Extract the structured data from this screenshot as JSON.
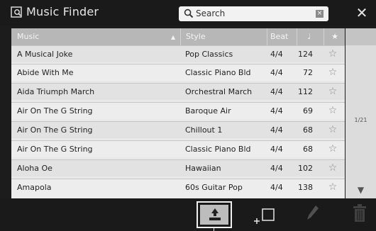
{
  "app": {
    "title": "Music Finder",
    "icon": "music-finder-icon"
  },
  "search": {
    "placeholder": "Search",
    "icon": "search-icon",
    "clear_icon": "clear-icon"
  },
  "close_icon": "close-icon",
  "columns": {
    "music": "Music",
    "style": "Style",
    "beat": "Beat",
    "tempo_icon": "quarter-note-icon",
    "favorite_icon": "star-icon"
  },
  "rows": [
    {
      "music": "A Musical Joke",
      "style": "Pop Classics",
      "beat": "4/4",
      "tempo": "124"
    },
    {
      "music": "Abide With Me",
      "style": "Classic Piano Bld",
      "beat": "4/4",
      "tempo": "72"
    },
    {
      "music": "Aida Triumph March",
      "style": "Orchestral March",
      "beat": "4/4",
      "tempo": "112"
    },
    {
      "music": "Air On The G String",
      "style": "Baroque Air",
      "beat": "4/4",
      "tempo": "69"
    },
    {
      "music": "Air On The G String",
      "style": "Chillout 1",
      "beat": "4/4",
      "tempo": "68"
    },
    {
      "music": "Air On The G String",
      "style": "Classic Piano Bld",
      "beat": "4/4",
      "tempo": "68"
    },
    {
      "music": "Aloha Oe",
      "style": "Hawaiian",
      "beat": "4/4",
      "tempo": "102"
    },
    {
      "music": "Amapola",
      "style": "60s Guitar Pop",
      "beat": "4/4",
      "tempo": "138"
    }
  ],
  "pager": {
    "text": "1/21"
  },
  "toolbar": {
    "select_icon": "select-record-icon",
    "add_icon": "add-record-icon",
    "edit_icon": "edit-pencil-icon",
    "delete_icon": "trash-icon"
  },
  "colors": {
    "header": "#b7b7b7",
    "row_odd": "#e2e2e2",
    "row_even": "#ededed",
    "background": "#1c1c1c"
  }
}
